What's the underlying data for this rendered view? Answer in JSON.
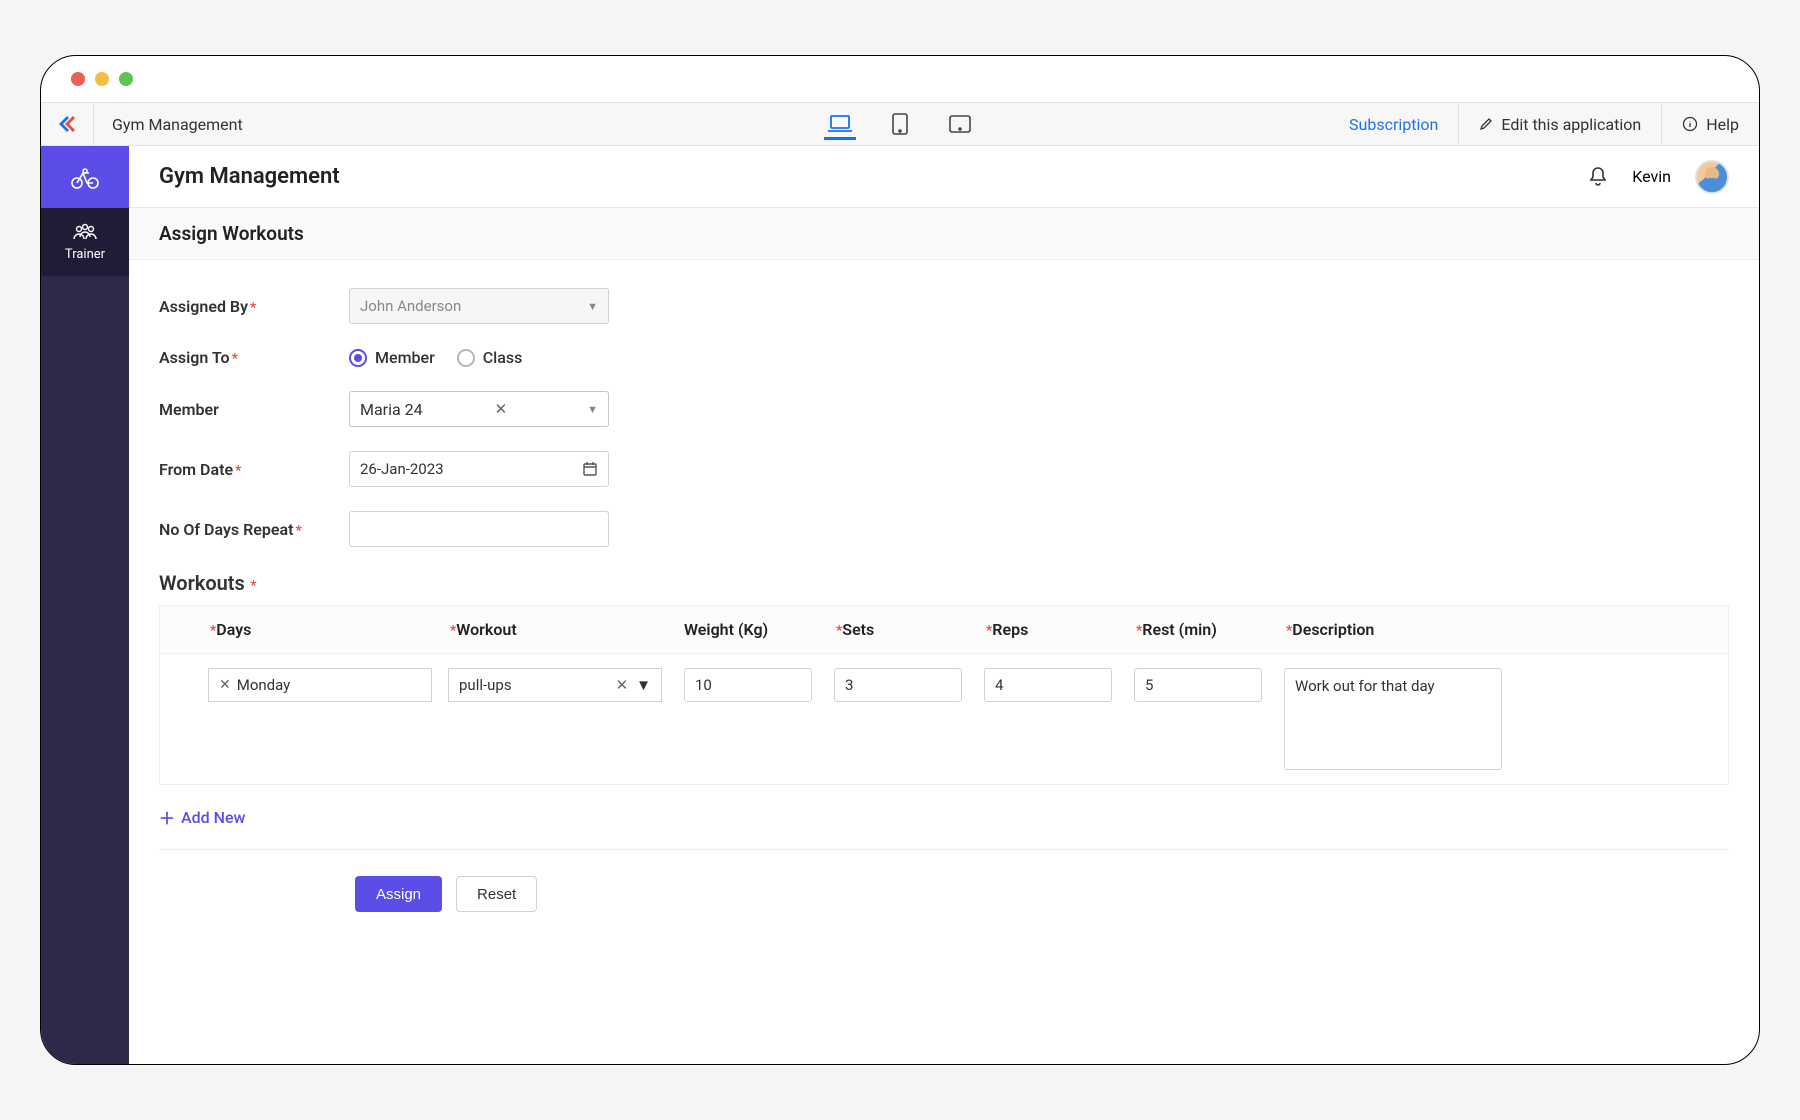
{
  "topbar": {
    "app_name": "Gym Management",
    "subscription": "Subscription",
    "edit": "Edit this application",
    "help": "Help"
  },
  "sidebar": {
    "trainer": "Trainer"
  },
  "header": {
    "title": "Gym Management",
    "username": "Kevin"
  },
  "subheader": {
    "title": "Assign Workouts"
  },
  "form": {
    "assigned_by": {
      "label": "Assigned By",
      "value": "John Anderson"
    },
    "assign_to": {
      "label": "Assign To",
      "opt_member": "Member",
      "opt_class": "Class"
    },
    "member": {
      "label": "Member",
      "value": "Maria 24"
    },
    "from_date": {
      "label": "From Date",
      "value": "26-Jan-2023"
    },
    "days_repeat": {
      "label": "No Of Days Repeat",
      "value": ""
    }
  },
  "workouts_section": {
    "title": "Workouts",
    "headers": {
      "days": "Days",
      "workout": "Workout",
      "weight": "Weight (Kg)",
      "sets": "Sets",
      "reps": "Reps",
      "rest": "Rest (min)",
      "description": "Description"
    },
    "row": {
      "day": "Monday",
      "workout": "pull-ups",
      "weight": "10",
      "sets": "3",
      "reps": "4",
      "rest": "5",
      "description": "Work out for that day"
    },
    "add_new": "Add New"
  },
  "actions": {
    "assign": "Assign",
    "reset": "Reset"
  }
}
